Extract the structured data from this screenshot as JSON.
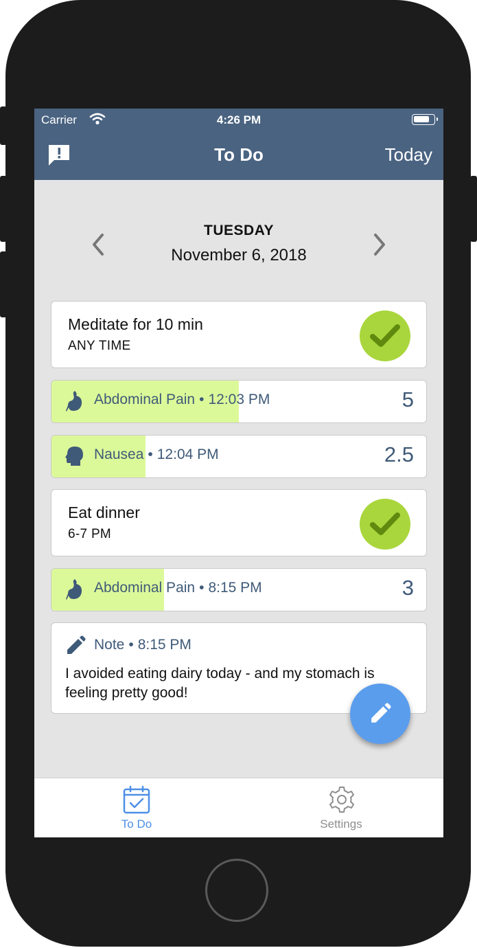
{
  "status_bar": {
    "carrier": "Carrier",
    "time": "4:26 PM"
  },
  "nav": {
    "title": "To Do",
    "today_label": "Today"
  },
  "date": {
    "weekday": "TUESDAY",
    "full_date": "November 6, 2018"
  },
  "items": [
    {
      "kind": "task",
      "title": "Meditate for 10 min",
      "subtitle": "ANY TIME",
      "completed": true
    },
    {
      "kind": "symptom",
      "name": "Abdominal Pain",
      "separator": "•",
      "time": "12:03 PM",
      "value": "5",
      "icon": "stomach-icon",
      "level_fraction": 0.5
    },
    {
      "kind": "symptom",
      "name": "Nausea",
      "separator": "•",
      "time": "12:04 PM",
      "value": "2.5",
      "icon": "head-icon",
      "level_fraction": 0.25
    },
    {
      "kind": "task",
      "title": "Eat dinner",
      "subtitle": "6-7 PM",
      "completed": true
    },
    {
      "kind": "symptom",
      "name": "Abdominal Pain",
      "separator": "•",
      "time": "8:15 PM",
      "value": "3",
      "icon": "stomach-icon",
      "level_fraction": 0.3
    },
    {
      "kind": "note",
      "label": "Note",
      "separator": "•",
      "time": "8:15 PM",
      "text": "I avoided eating dairy today - and my stomach is feeling pretty good!",
      "icon": "pencil-icon"
    }
  ],
  "tabs": [
    {
      "label": "To Do",
      "icon": "calendar-check-icon",
      "active": true
    },
    {
      "label": "Settings",
      "icon": "gear-icon",
      "active": false
    }
  ],
  "colors": {
    "header": "#4a6381",
    "accent": "#4d8fe6",
    "check": "#a9d63c",
    "symptom_fill": "#dcf99a",
    "fab": "#5b9ded"
  }
}
